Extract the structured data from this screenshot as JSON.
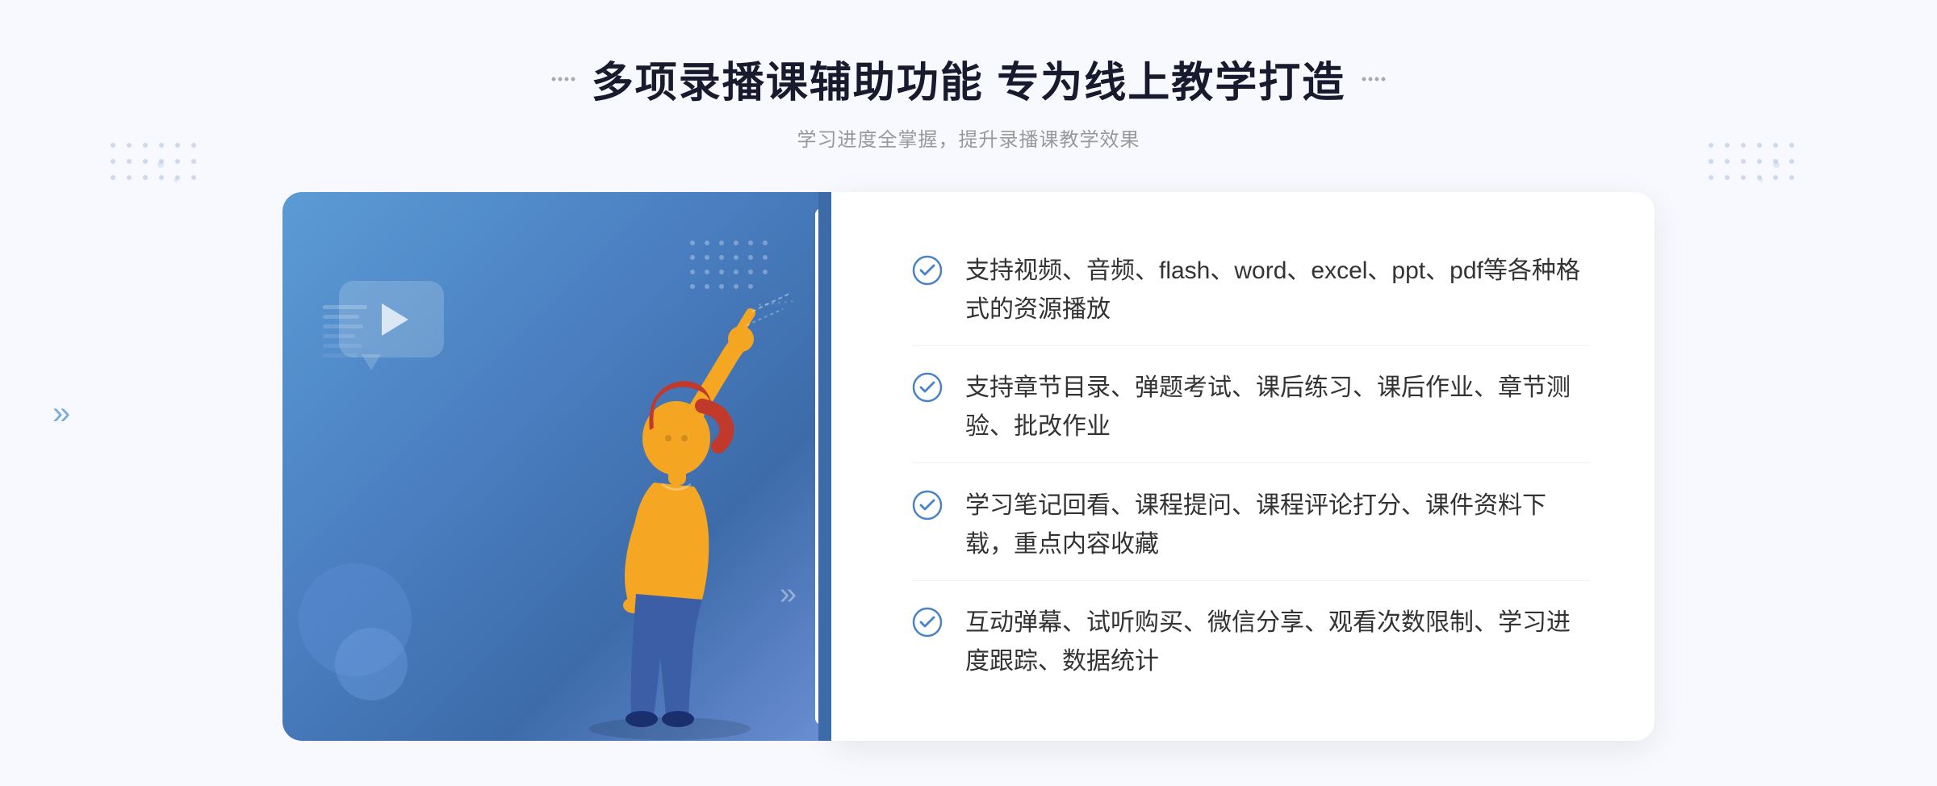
{
  "page": {
    "background": "#f5f7ff"
  },
  "header": {
    "title": "多项录播课辅助功能 专为线上教学打造",
    "subtitle": "学习进度全掌握，提升录播课教学效果",
    "decoration_dots": "··· ···"
  },
  "features": [
    {
      "id": 1,
      "text": "支持视频、音频、flash、word、excel、ppt、pdf等各种格式的资源播放"
    },
    {
      "id": 2,
      "text": "支持章节目录、弹题考试、课后练习、课后作业、章节测验、批改作业"
    },
    {
      "id": 3,
      "text": "学习笔记回看、课程提问、课程评论打分、课件资料下载，重点内容收藏"
    },
    {
      "id": 4,
      "text": "互动弹幕、试听购买、微信分享、观看次数限制、学习进度跟踪、数据统计"
    }
  ],
  "icons": {
    "check_circle": "check-circle-icon",
    "play": "play-icon",
    "chevron": "chevron-icon"
  },
  "colors": {
    "primary": "#4a82c8",
    "title": "#1a1a2e",
    "text": "#333333",
    "subtitle": "#999999",
    "bg": "#f5f7ff"
  }
}
